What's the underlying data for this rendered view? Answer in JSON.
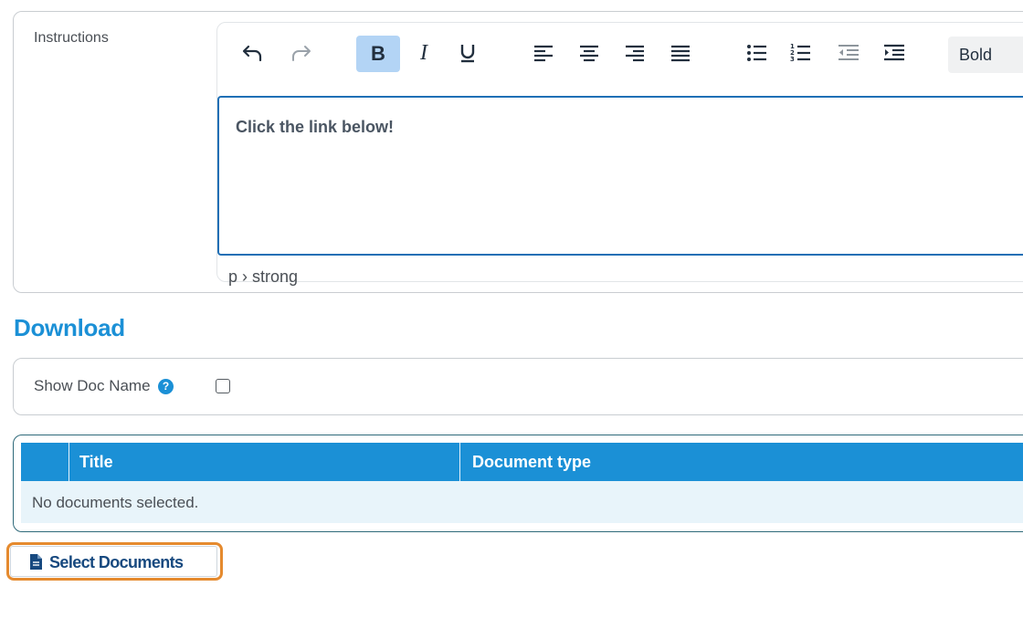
{
  "instructions": {
    "label": "Instructions",
    "editor": {
      "toolbar": {
        "undo": "undo-icon",
        "redo": "redo-icon",
        "bold_label": "B",
        "italic_label": "I",
        "underline": "underline-icon",
        "align_left": "align-left-icon",
        "align_center": "align-center-icon",
        "align_right": "align-right-icon",
        "align_justify": "align-justify-icon",
        "bullet_list": "bullet-list-icon",
        "numbered_list": "numbered-list-icon",
        "outdent": "outdent-icon",
        "indent": "indent-icon",
        "format_value": "Bold"
      },
      "content": "Click the link below!",
      "status_path": "p › strong"
    }
  },
  "download": {
    "title": "Download",
    "show_doc_name_label": "Show Doc Name",
    "help_glyph": "?",
    "show_doc_name_checked": false,
    "table": {
      "columns": [
        "Title",
        "Document type"
      ],
      "empty_message": "No documents selected."
    },
    "select_button_label": "Select Documents"
  },
  "colors": {
    "accent": "#1b90d6",
    "highlight": "#e58a2e",
    "active_toolbar": "#b3d4f5"
  }
}
